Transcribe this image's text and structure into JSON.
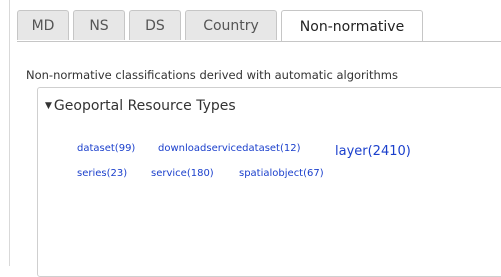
{
  "tabs": [
    {
      "label": "MD",
      "active": false
    },
    {
      "label": "NS",
      "active": false
    },
    {
      "label": "DS",
      "active": false
    },
    {
      "label": "Country",
      "active": false
    },
    {
      "label": "Non-normative",
      "active": true
    }
  ],
  "description": "Non-normative classifications derived with automatic algorithms",
  "panel": {
    "title": "Geoportal Resource Types",
    "caret_icon": "caret-down-icon",
    "tags": [
      {
        "label": "dataset(99)",
        "size": "small"
      },
      {
        "label": "downloadservicedataset(12)",
        "size": "small"
      },
      {
        "label": "layer(2410)",
        "size": "large"
      },
      {
        "label": "series(23)",
        "size": "small"
      },
      {
        "label": "service(180)",
        "size": "small"
      },
      {
        "label": "spatialobject(67)",
        "size": "small"
      }
    ]
  },
  "colors": {
    "link": "#1a3fcc",
    "tab_inactive_bg": "#e7e7e7",
    "border": "#c6c6c6"
  }
}
